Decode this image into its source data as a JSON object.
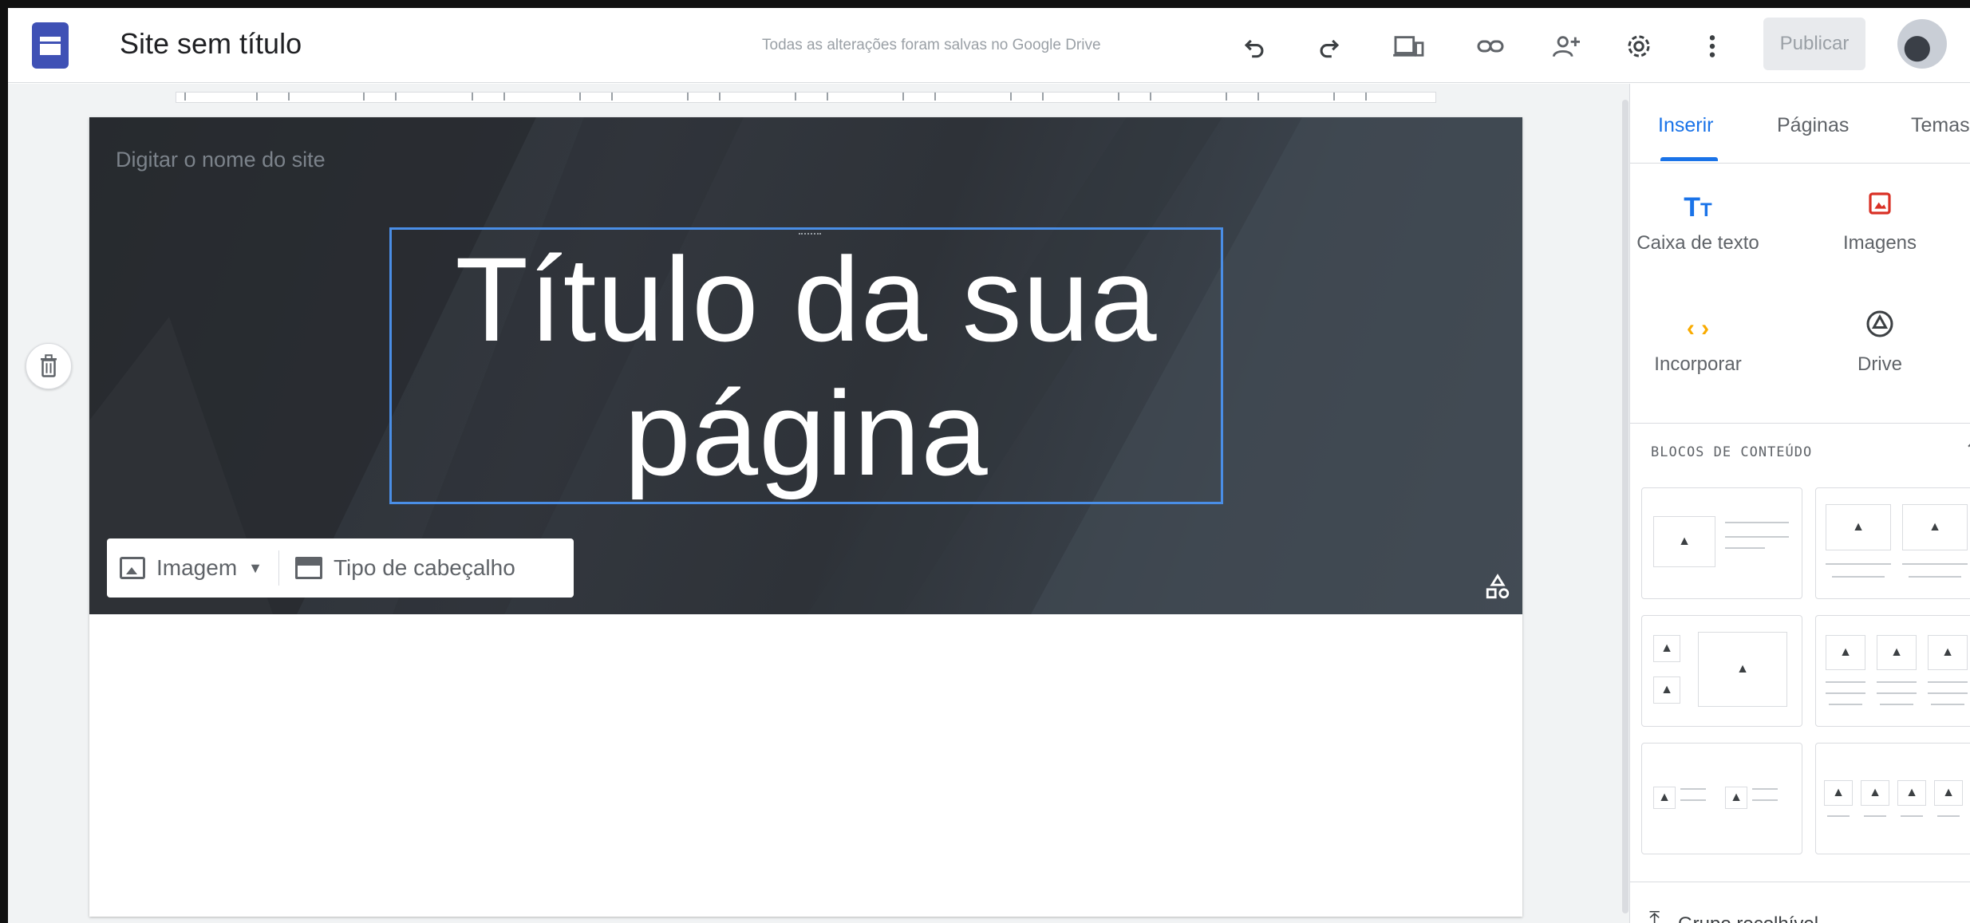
{
  "app": {
    "site_title": "Site sem título",
    "save_status": "Todas as alterações foram salvas no Google Drive",
    "publish_label": "Publicar"
  },
  "toolbar_icons": [
    "undo-icon",
    "redo-icon",
    "preview-icon",
    "link-icon",
    "share-icon",
    "settings-icon",
    "more-icon"
  ],
  "canvas": {
    "site_name_placeholder": "Digitar o nome do site",
    "page_title_line1": "Título da sua",
    "page_title_line2": "página",
    "image_menu_label": "Imagem",
    "header_type_label": "Tipo de cabeçalho"
  },
  "panel": {
    "tabs": [
      "Inserir",
      "Páginas",
      "Temas"
    ],
    "insert_items": [
      {
        "label": "Caixa de texto",
        "icon": "text-box-icon"
      },
      {
        "label": "Imagens",
        "icon": "images-icon"
      },
      {
        "label": "Incorporar",
        "icon": "embed-icon"
      },
      {
        "label": "Drive",
        "icon": "drive-icon"
      }
    ],
    "blocks_heading": "BLOCOS DE CONTEÚDO",
    "collapsible_label": "Grupo recolhível"
  },
  "colors": {
    "accent": "#1a73e8",
    "images_icon": "#d93025",
    "embed_icon": "#f9ab00",
    "selection_border": "#4a8ee6"
  }
}
